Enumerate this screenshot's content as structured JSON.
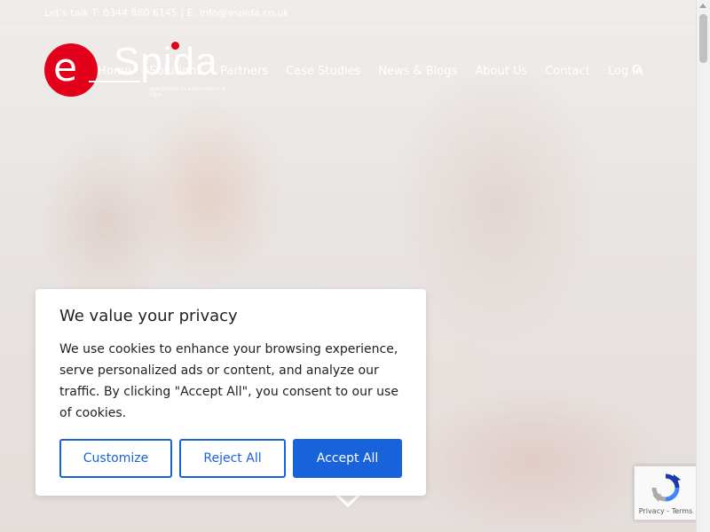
{
  "topbar": {
    "contact": "Let's talk T: 0344 880 6145 | E: info@espida.co.uk"
  },
  "logo": {
    "e": "e",
    "name": "Spida",
    "tagline": "specialists in automation & CRM"
  },
  "nav": {
    "items": [
      {
        "label": "Home",
        "active": true
      },
      {
        "label": "Solutions"
      },
      {
        "label": "Partners"
      },
      {
        "label": "Case Studies"
      },
      {
        "label": "News & Blogs"
      },
      {
        "label": "About Us"
      },
      {
        "label": "Contact"
      },
      {
        "label": "Log In"
      }
    ]
  },
  "cookie": {
    "title": "We value your privacy",
    "body": "We use cookies to enhance your browsing experience, serve personalized ads or content, and analyze our traffic. By clicking \"Accept All\", you consent to our use of cookies.",
    "customize": "Customize",
    "reject": "Reject All",
    "accept": "Accept All"
  },
  "recaptcha": {
    "terms": "Privacy - Terms"
  },
  "colors": {
    "brand_red": "#e3001b",
    "button_blue": "#1863dc"
  }
}
